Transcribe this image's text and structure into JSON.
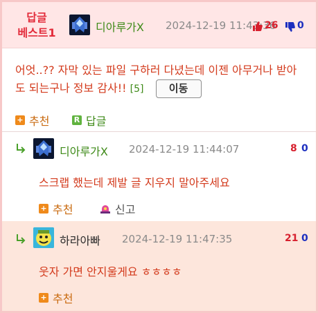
{
  "best": {
    "badge_line1": "답글",
    "badge_line2": "베스트1",
    "nickname": "디아루가X",
    "date": "2024-12-19 11:43:36",
    "up_count": "26",
    "down_count": "0",
    "text": "어엇..?? 자막 있는 파일 구하러 다녔는데 이젠 아무거나 받아도 되는구나 정보 감사!!",
    "reply_count": "[5]",
    "move_label": "이동",
    "recommend_label": "추천",
    "recommend_icon": "+",
    "reply_label": "답글",
    "reply_icon": "R"
  },
  "replies": [
    {
      "nickname": "디아루가X",
      "date": "2024-12-19 11:44:07",
      "up_count": "8",
      "down_count": "0",
      "text": "스크랩 했는데 제발 글 지우지 말아주세요",
      "recommend_label": "추천",
      "report_label": "신고"
    },
    {
      "nickname": "하라아빠",
      "date": "2024-12-19 11:47:35",
      "up_count": "21",
      "down_count": "0",
      "text": "웃자 가면 안지울게요 ㅎㅎㅎㅎ",
      "recommend_label": "추천"
    }
  ],
  "colors": {
    "accent_red": "#e22b3a",
    "nick_green": "#3e8a18",
    "text_red": "#d33a1c",
    "down_blue": "#1d2fbf",
    "header_bg": "#ffe6e6",
    "highlight_bg": "#fde6dc"
  },
  "icons": {
    "thumb_up": "thumb-up-icon",
    "thumb_down": "thumb-down-icon",
    "reply_arrow": "reply-arrow-icon",
    "report": "siren-icon"
  }
}
